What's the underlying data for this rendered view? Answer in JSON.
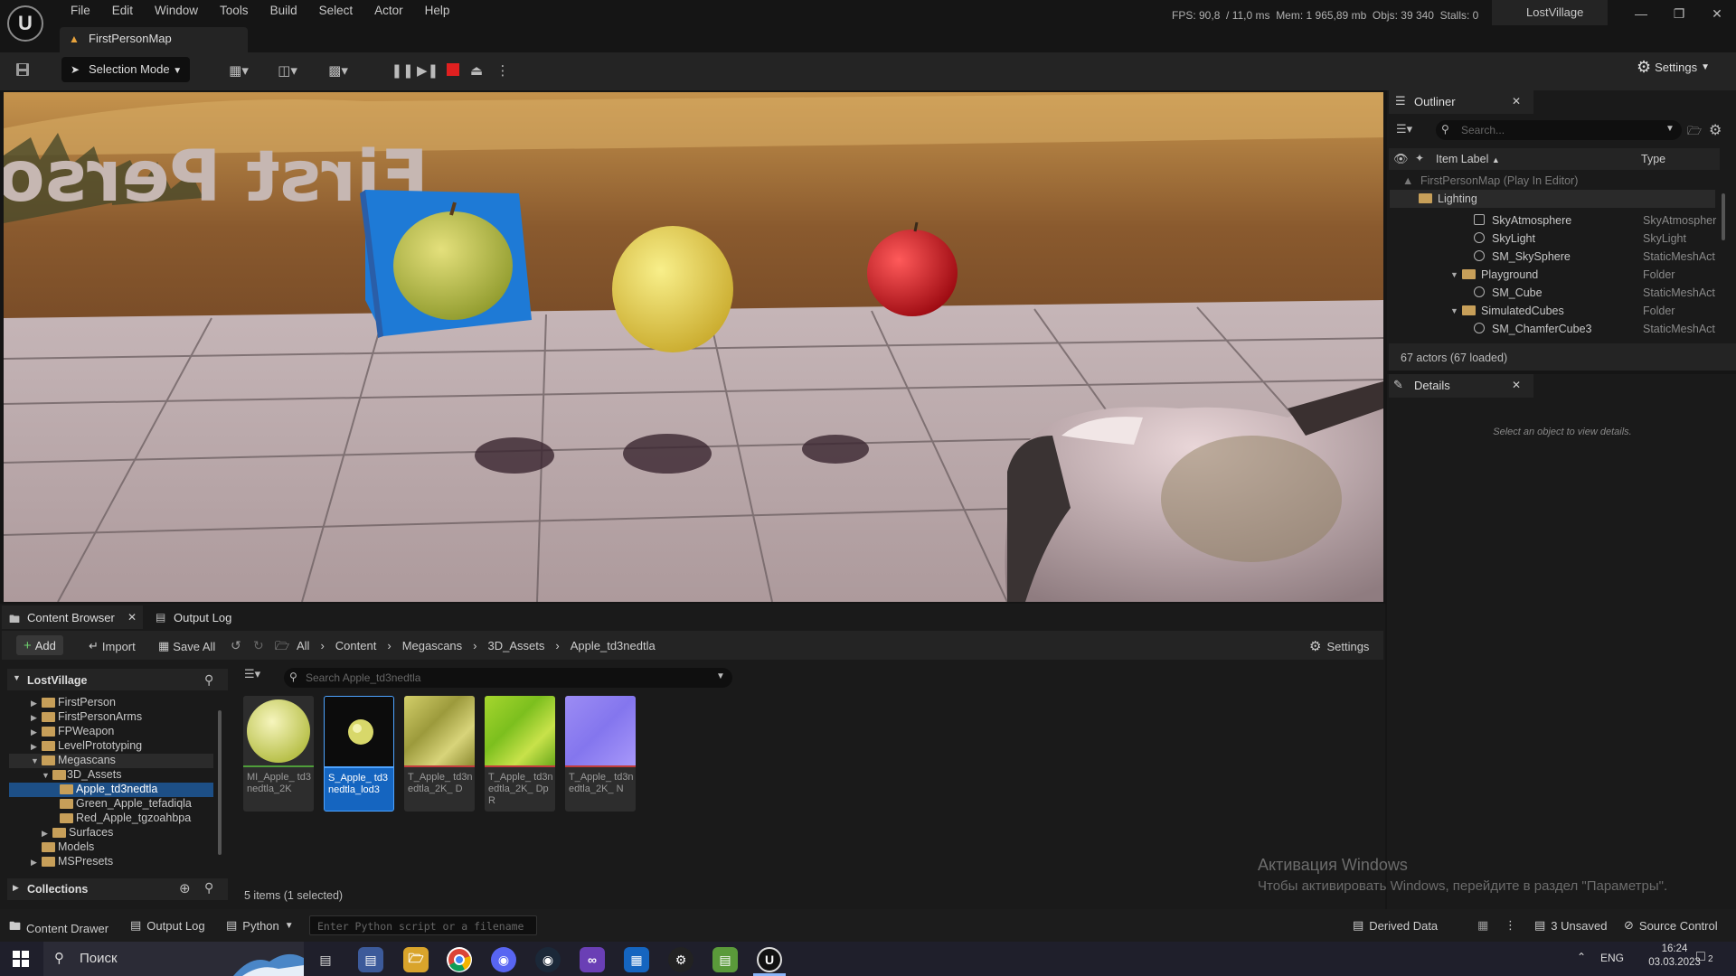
{
  "menu": [
    "File",
    "Edit",
    "Window",
    "Tools",
    "Build",
    "Select",
    "Actor",
    "Help"
  ],
  "stats": {
    "fps": "FPS: 90,8",
    "ms": "/ 11,0 ms",
    "mem": "Mem: 1 965,89 mb",
    "objs": "Objs: 39 340",
    "stalls": "Stalls: 0"
  },
  "project_name": "LostVillage",
  "map_tab": "FirstPersonMap",
  "toolbar": {
    "selection_mode": "Selection Mode",
    "settings": "Settings"
  },
  "viewport": {
    "wall_text": "First Person Template"
  },
  "outliner": {
    "title": "Outliner",
    "search_placeholder": "Search...",
    "col_label": "Item Label",
    "col_type": "Type",
    "rows": [
      {
        "label": "FirstPersonMap (Play In Editor)",
        "type": ""
      },
      {
        "label": "Lighting",
        "type": ""
      },
      {
        "label": "SkyAtmosphere",
        "type": "SkyAtmospher"
      },
      {
        "label": "SkyLight",
        "type": "SkyLight"
      },
      {
        "label": "SM_SkySphere",
        "type": "StaticMeshAct"
      },
      {
        "label": "Playground",
        "type": "Folder"
      },
      {
        "label": "SM_Cube",
        "type": "StaticMeshAct"
      },
      {
        "label": "SimulatedCubes",
        "type": "Folder"
      },
      {
        "label": "SM_ChamferCube3",
        "type": "StaticMeshAct"
      }
    ],
    "footer": "67 actors (67 loaded)"
  },
  "details": {
    "title": "Details",
    "empty": "Select an object to view details."
  },
  "content_browser": {
    "tab": "Content Browser",
    "output_tab": "Output Log",
    "add": "Add",
    "import": "Import",
    "save_all": "Save All",
    "breadcrumb": [
      "All",
      "Content",
      "Megascans",
      "3D_Assets",
      "Apple_td3nedtla"
    ],
    "settings": "Settings",
    "root": "LostVillage",
    "search_placeholder": "Search Apple_td3nedtla",
    "tree": [
      "FirstPerson",
      "FirstPersonArms",
      "FPWeapon",
      "LevelPrototyping",
      "Megascans",
      "3D_Assets",
      "Apple_td3nedtla",
      "Green_Apple_tefadiqla",
      "Red_Apple_tgzoahbpa",
      "Surfaces",
      "Models",
      "MSPresets"
    ],
    "collections": "Collections",
    "assets": [
      {
        "name": "MI_Apple_ td3nedtla_2K"
      },
      {
        "name": "S_Apple_ td3nedtla_lod3"
      },
      {
        "name": "T_Apple_ td3nedtla_2K_ D"
      },
      {
        "name": "T_Apple_ td3nedtla_2K_ DpR"
      },
      {
        "name": "T_Apple_ td3nedtla_2K_ N"
      }
    ],
    "status": "5 items (1 selected)"
  },
  "statusbar": {
    "content_drawer": "Content Drawer",
    "output_log": "Output Log",
    "python": "Python",
    "python_placeholder": "Enter Python script or a filename",
    "derived_data": "Derived Data",
    "unsaved": "3 Unsaved",
    "source_control": "Source Control"
  },
  "watermark": {
    "line1": "Активация Windows",
    "line2": "Чтобы активировать Windows, перейдите в раздел \"Параметры\"."
  },
  "taskbar": {
    "search": "Поиск",
    "lang": "ENG",
    "time": "16:24",
    "date": "03.03.2023",
    "notif": "2"
  }
}
